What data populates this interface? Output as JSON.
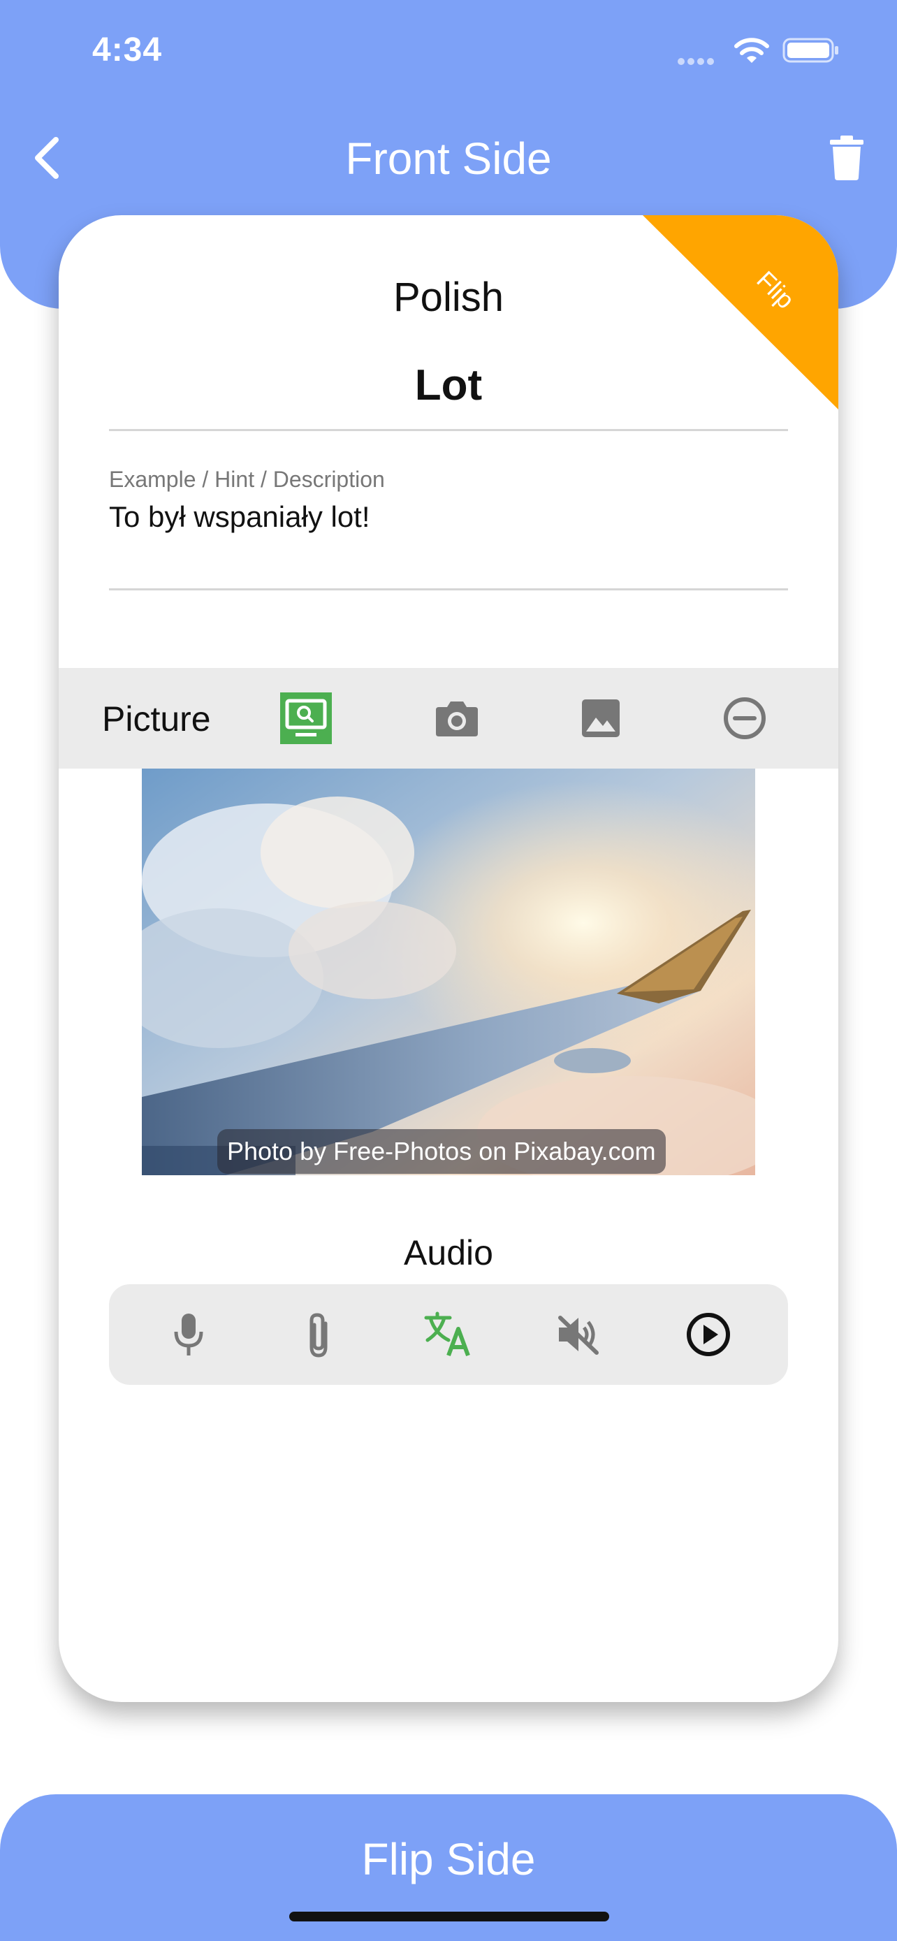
{
  "status_bar": {
    "time": "4:34"
  },
  "header": {
    "title": "Front Side"
  },
  "card": {
    "flip_ribbon_label": "Flip",
    "language": "Polish",
    "word": "Lot",
    "hint_label": "Example / Hint / Description",
    "hint_value": "To był wspaniały lot!"
  },
  "picture": {
    "label": "Picture",
    "buttons": [
      "image-search-icon",
      "camera-icon",
      "gallery-icon",
      "remove-icon"
    ],
    "credit": "Photo by Free-Photos on Pixabay.com"
  },
  "audio": {
    "label": "Audio",
    "buttons": [
      "microphone-icon",
      "paperclip-icon",
      "translate-icon",
      "volume-off-icon",
      "play-circle-icon"
    ]
  },
  "footer": {
    "flip_button_label": "Flip Side"
  },
  "colors": {
    "header_blue": "#7da1f7",
    "ribbon_orange": "#ffa500",
    "active_green": "#4caf50",
    "icon_gray": "#777777",
    "bar_gray": "#ebebeb"
  }
}
